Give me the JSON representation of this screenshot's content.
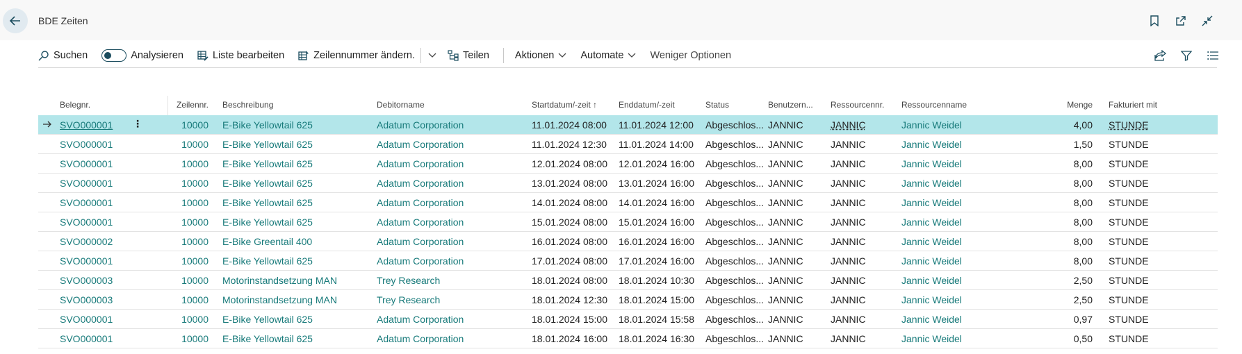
{
  "page": {
    "title": "BDE Zeiten"
  },
  "actions": {
    "search": "Suchen",
    "analyze": "Analysieren",
    "edit_list": "Liste bearbeiten",
    "change_line_no": "Zeilennummer ändern.",
    "share": "Teilen",
    "actions": "Aktionen",
    "automate": "Automate",
    "fewer_options": "Weniger Optionen"
  },
  "columns": {
    "beleg": "Belegnr.",
    "zeile": "Zeilennr.",
    "beschr": "Beschreibung",
    "debit": "Debitorname",
    "start": "Startdatum/-zeit ↑",
    "end": "Enddatum/-zeit",
    "status": "Status",
    "benutz": "Benutzern...",
    "ress": "Ressourcennr.",
    "rname": "Ressourcenname",
    "menge": "Menge",
    "fakt": "Fakturiert mit"
  },
  "rows": [
    {
      "beleg": "SVO000001",
      "zeile": "10000",
      "beschr": "E-Bike Yellowtail 625",
      "debit": "Adatum Corporation",
      "start": "11.01.2024 08:00",
      "end": "11.01.2024 12:00",
      "status": "Abgeschlos...",
      "benutz": "JANNIC",
      "ress": "JANNIC",
      "rname": "Jannic Weidel",
      "menge": "4,00",
      "fakt": "STUNDE"
    },
    {
      "beleg": "SVO000001",
      "zeile": "10000",
      "beschr": "E-Bike Yellowtail 625",
      "debit": "Adatum Corporation",
      "start": "11.01.2024 12:30",
      "end": "11.01.2024 14:00",
      "status": "Abgeschlos...",
      "benutz": "JANNIC",
      "ress": "JANNIC",
      "rname": "Jannic Weidel",
      "menge": "1,50",
      "fakt": "STUNDE"
    },
    {
      "beleg": "SVO000001",
      "zeile": "10000",
      "beschr": "E-Bike Yellowtail 625",
      "debit": "Adatum Corporation",
      "start": "12.01.2024 08:00",
      "end": "12.01.2024 16:00",
      "status": "Abgeschlos...",
      "benutz": "JANNIC",
      "ress": "JANNIC",
      "rname": "Jannic Weidel",
      "menge": "8,00",
      "fakt": "STUNDE"
    },
    {
      "beleg": "SVO000001",
      "zeile": "10000",
      "beschr": "E-Bike Yellowtail 625",
      "debit": "Adatum Corporation",
      "start": "13.01.2024 08:00",
      "end": "13.01.2024 16:00",
      "status": "Abgeschlos...",
      "benutz": "JANNIC",
      "ress": "JANNIC",
      "rname": "Jannic Weidel",
      "menge": "8,00",
      "fakt": "STUNDE"
    },
    {
      "beleg": "SVO000001",
      "zeile": "10000",
      "beschr": "E-Bike Yellowtail 625",
      "debit": "Adatum Corporation",
      "start": "14.01.2024 08:00",
      "end": "14.01.2024 16:00",
      "status": "Abgeschlos...",
      "benutz": "JANNIC",
      "ress": "JANNIC",
      "rname": "Jannic Weidel",
      "menge": "8,00",
      "fakt": "STUNDE"
    },
    {
      "beleg": "SVO000001",
      "zeile": "10000",
      "beschr": "E-Bike Yellowtail 625",
      "debit": "Adatum Corporation",
      "start": "15.01.2024 08:00",
      "end": "15.01.2024 16:00",
      "status": "Abgeschlos...",
      "benutz": "JANNIC",
      "ress": "JANNIC",
      "rname": "Jannic Weidel",
      "menge": "8,00",
      "fakt": "STUNDE"
    },
    {
      "beleg": "SVO000002",
      "zeile": "10000",
      "beschr": "E-Bike Greentail 400",
      "debit": "Adatum Corporation",
      "start": "16.01.2024 08:00",
      "end": "16.01.2024 16:00",
      "status": "Abgeschlos...",
      "benutz": "JANNIC",
      "ress": "JANNIC",
      "rname": "Jannic Weidel",
      "menge": "8,00",
      "fakt": "STUNDE"
    },
    {
      "beleg": "SVO000001",
      "zeile": "10000",
      "beschr": "E-Bike Yellowtail 625",
      "debit": "Adatum Corporation",
      "start": "17.01.2024 08:00",
      "end": "17.01.2024 16:00",
      "status": "Abgeschlos...",
      "benutz": "JANNIC",
      "ress": "JANNIC",
      "rname": "Jannic Weidel",
      "menge": "8,00",
      "fakt": "STUNDE"
    },
    {
      "beleg": "SVO000003",
      "zeile": "10000",
      "beschr": "Motorinstandsetzung MAN",
      "debit": "Trey Research",
      "start": "18.01.2024 08:00",
      "end": "18.01.2024 10:30",
      "status": "Abgeschlos...",
      "benutz": "JANNIC",
      "ress": "JANNIC",
      "rname": "Jannic Weidel",
      "menge": "2,50",
      "fakt": "STUNDE"
    },
    {
      "beleg": "SVO000003",
      "zeile": "10000",
      "beschr": "Motorinstandsetzung MAN",
      "debit": "Trey Research",
      "start": "18.01.2024 12:30",
      "end": "18.01.2024 15:00",
      "status": "Abgeschlos...",
      "benutz": "JANNIC",
      "ress": "JANNIC",
      "rname": "Jannic Weidel",
      "menge": "2,50",
      "fakt": "STUNDE"
    },
    {
      "beleg": "SVO000001",
      "zeile": "10000",
      "beschr": "E-Bike Yellowtail 625",
      "debit": "Adatum Corporation",
      "start": "18.01.2024 15:00",
      "end": "18.01.2024 15:58",
      "status": "Abgeschlos...",
      "benutz": "JANNIC",
      "ress": "JANNIC",
      "rname": "Jannic Weidel",
      "menge": "0,97",
      "fakt": "STUNDE"
    },
    {
      "beleg": "SVO000001",
      "zeile": "10000",
      "beschr": "E-Bike Yellowtail 625",
      "debit": "Adatum Corporation",
      "start": "18.01.2024 16:00",
      "end": "18.01.2024 16:30",
      "status": "Abgeschlos...",
      "benutz": "JANNIC",
      "ress": "JANNIC",
      "rname": "Jannic Weidel",
      "menge": "0,50",
      "fakt": "STUNDE"
    }
  ],
  "selected_row": 0,
  "icons": {
    "back": "back-arrow-icon",
    "bookmark": "bookmark-icon",
    "open_new": "open-new-window-icon",
    "collapse": "collapse-icon",
    "search": "search-icon",
    "edit_list": "edit-list-icon",
    "change_line": "change-line-icon",
    "share": "share-icon",
    "share_page": "share-page-icon",
    "filter": "filter-icon",
    "list_view": "list-view-icon",
    "row_arrow": "row-arrow-icon",
    "more": "more-options-icon"
  },
  "colors": {
    "accent": "#177a7a",
    "selected_row": "#b3e6ea",
    "header_bg": "#f8f8f8"
  }
}
